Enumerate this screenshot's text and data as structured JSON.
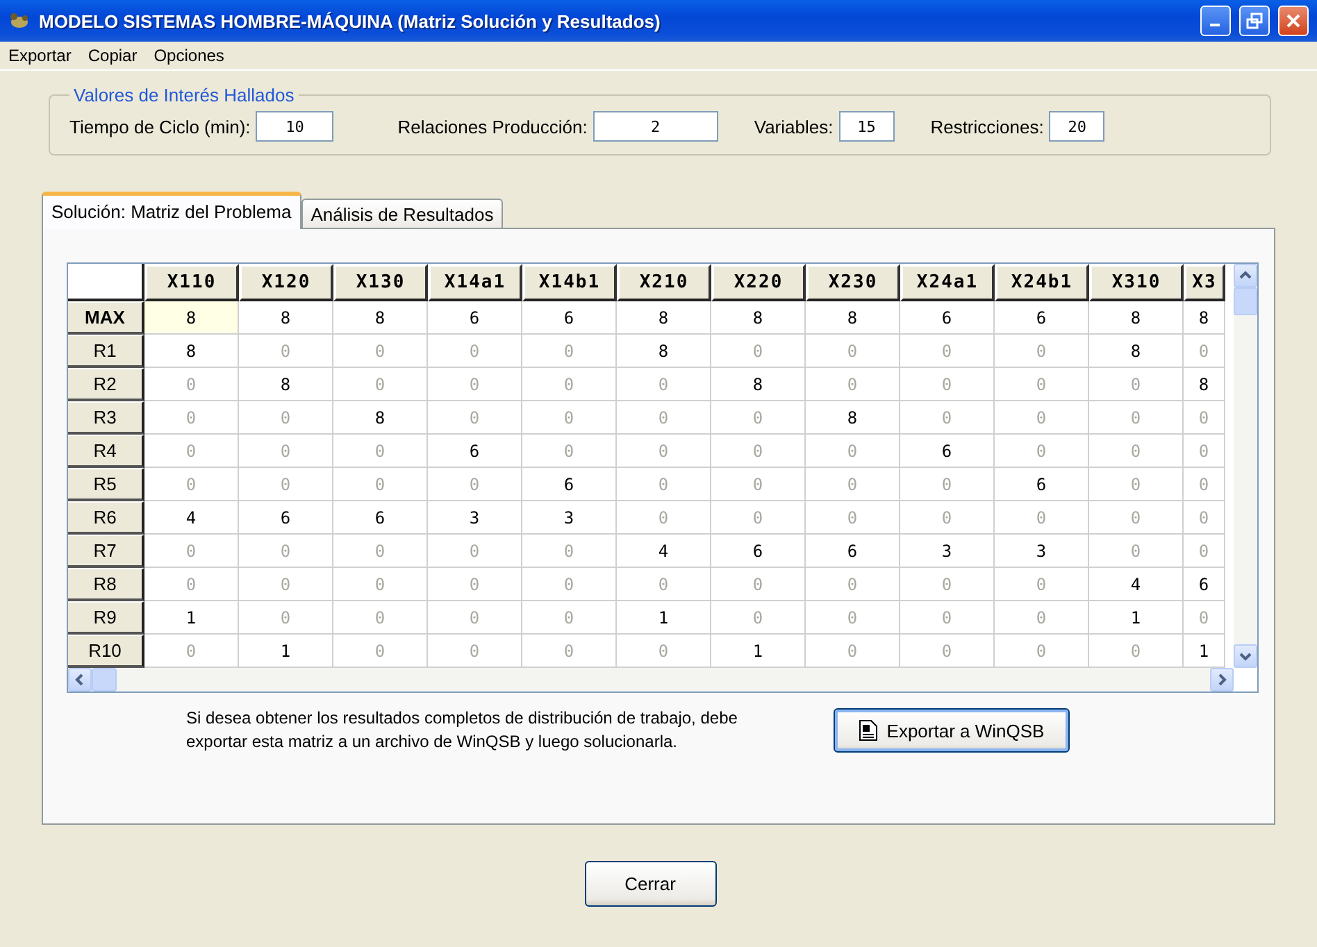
{
  "window": {
    "title": "MODELO SISTEMAS HOMBRE-MÁQUINA (Matriz Solución y Resultados)"
  },
  "menu": [
    "Exportar",
    "Copiar",
    "Opciones"
  ],
  "summary": {
    "title": "Valores de Interés Hallados",
    "fields": [
      {
        "label": "Tiempo de Ciclo (min):",
        "value": "10"
      },
      {
        "label": "Relaciones Producción:",
        "value": "2"
      },
      {
        "label": "Variables:",
        "value": "15"
      },
      {
        "label": "Restricciones:",
        "value": "20"
      }
    ]
  },
  "tabs": [
    {
      "label": "Solución: Matriz del Problema",
      "selected": true
    },
    {
      "label": "Análisis de Resultados",
      "selected": false
    }
  ],
  "table": {
    "columns": [
      "X110",
      "X120",
      "X130",
      "X14a1",
      "X14b1",
      "X210",
      "X220",
      "X230",
      "X24a1",
      "X24b1",
      "X310",
      "X3"
    ],
    "rows": [
      {
        "header": "MAX",
        "cells": [
          {
            "v": "8",
            "selected": true
          },
          {
            "v": "8",
            "selected": false
          },
          {
            "v": "8",
            "selected": false
          },
          {
            "v": "6",
            "selected": false
          },
          {
            "v": "6",
            "selected": false
          },
          {
            "v": "8",
            "selected": false
          },
          {
            "v": "8",
            "selected": false
          },
          {
            "v": "8",
            "selected": false
          },
          {
            "v": "6",
            "selected": false
          },
          {
            "v": "6",
            "selected": false
          },
          {
            "v": "8",
            "selected": false
          },
          {
            "v": "8",
            "selected": false
          }
        ]
      },
      {
        "header": "R1",
        "cells": [
          {
            "v": "8",
            "selected": false
          },
          {
            "v": "0",
            "selected": false
          },
          {
            "v": "0",
            "selected": false
          },
          {
            "v": "0",
            "selected": false
          },
          {
            "v": "0",
            "selected": false
          },
          {
            "v": "8",
            "selected": false
          },
          {
            "v": "0",
            "selected": false
          },
          {
            "v": "0",
            "selected": false
          },
          {
            "v": "0",
            "selected": false
          },
          {
            "v": "0",
            "selected": false
          },
          {
            "v": "8",
            "selected": false
          },
          {
            "v": "0",
            "selected": false
          }
        ]
      },
      {
        "header": "R2",
        "cells": [
          {
            "v": "0",
            "selected": false
          },
          {
            "v": "8",
            "selected": false
          },
          {
            "v": "0",
            "selected": false
          },
          {
            "v": "0",
            "selected": false
          },
          {
            "v": "0",
            "selected": false
          },
          {
            "v": "0",
            "selected": false
          },
          {
            "v": "8",
            "selected": false
          },
          {
            "v": "0",
            "selected": false
          },
          {
            "v": "0",
            "selected": false
          },
          {
            "v": "0",
            "selected": false
          },
          {
            "v": "0",
            "selected": false
          },
          {
            "v": "8",
            "selected": false
          }
        ]
      },
      {
        "header": "R3",
        "cells": [
          {
            "v": "0",
            "selected": false
          },
          {
            "v": "0",
            "selected": false
          },
          {
            "v": "8",
            "selected": false
          },
          {
            "v": "0",
            "selected": false
          },
          {
            "v": "0",
            "selected": false
          },
          {
            "v": "0",
            "selected": false
          },
          {
            "v": "0",
            "selected": false
          },
          {
            "v": "8",
            "selected": false
          },
          {
            "v": "0",
            "selected": false
          },
          {
            "v": "0",
            "selected": false
          },
          {
            "v": "0",
            "selected": false
          },
          {
            "v": "0",
            "selected": false
          }
        ]
      },
      {
        "header": "R4",
        "cells": [
          {
            "v": "0",
            "selected": false
          },
          {
            "v": "0",
            "selected": false
          },
          {
            "v": "0",
            "selected": false
          },
          {
            "v": "6",
            "selected": false
          },
          {
            "v": "0",
            "selected": false
          },
          {
            "v": "0",
            "selected": false
          },
          {
            "v": "0",
            "selected": false
          },
          {
            "v": "0",
            "selected": false
          },
          {
            "v": "6",
            "selected": false
          },
          {
            "v": "0",
            "selected": false
          },
          {
            "v": "0",
            "selected": false
          },
          {
            "v": "0",
            "selected": false
          }
        ]
      },
      {
        "header": "R5",
        "cells": [
          {
            "v": "0",
            "selected": false
          },
          {
            "v": "0",
            "selected": false
          },
          {
            "v": "0",
            "selected": false
          },
          {
            "v": "0",
            "selected": false
          },
          {
            "v": "6",
            "selected": false
          },
          {
            "v": "0",
            "selected": false
          },
          {
            "v": "0",
            "selected": false
          },
          {
            "v": "0",
            "selected": false
          },
          {
            "v": "0",
            "selected": false
          },
          {
            "v": "6",
            "selected": false
          },
          {
            "v": "0",
            "selected": false
          },
          {
            "v": "0",
            "selected": false
          }
        ]
      },
      {
        "header": "R6",
        "cells": [
          {
            "v": "4",
            "selected": false
          },
          {
            "v": "6",
            "selected": false
          },
          {
            "v": "6",
            "selected": false
          },
          {
            "v": "3",
            "selected": false
          },
          {
            "v": "3",
            "selected": false
          },
          {
            "v": "0",
            "selected": false
          },
          {
            "v": "0",
            "selected": false
          },
          {
            "v": "0",
            "selected": false
          },
          {
            "v": "0",
            "selected": false
          },
          {
            "v": "0",
            "selected": false
          },
          {
            "v": "0",
            "selected": false
          },
          {
            "v": "0",
            "selected": false
          }
        ]
      },
      {
        "header": "R7",
        "cells": [
          {
            "v": "0",
            "selected": false
          },
          {
            "v": "0",
            "selected": false
          },
          {
            "v": "0",
            "selected": false
          },
          {
            "v": "0",
            "selected": false
          },
          {
            "v": "0",
            "selected": false
          },
          {
            "v": "4",
            "selected": false
          },
          {
            "v": "6",
            "selected": false
          },
          {
            "v": "6",
            "selected": false
          },
          {
            "v": "3",
            "selected": false
          },
          {
            "v": "3",
            "selected": false
          },
          {
            "v": "0",
            "selected": false
          },
          {
            "v": "0",
            "selected": false
          }
        ]
      },
      {
        "header": "R8",
        "cells": [
          {
            "v": "0",
            "selected": false
          },
          {
            "v": "0",
            "selected": false
          },
          {
            "v": "0",
            "selected": false
          },
          {
            "v": "0",
            "selected": false
          },
          {
            "v": "0",
            "selected": false
          },
          {
            "v": "0",
            "selected": false
          },
          {
            "v": "0",
            "selected": false
          },
          {
            "v": "0",
            "selected": false
          },
          {
            "v": "0",
            "selected": false
          },
          {
            "v": "0",
            "selected": false
          },
          {
            "v": "4",
            "selected": false
          },
          {
            "v": "6",
            "selected": false
          }
        ]
      },
      {
        "header": "R9",
        "cells": [
          {
            "v": "1",
            "selected": false
          },
          {
            "v": "0",
            "selected": false
          },
          {
            "v": "0",
            "selected": false
          },
          {
            "v": "0",
            "selected": false
          },
          {
            "v": "0",
            "selected": false
          },
          {
            "v": "1",
            "selected": false
          },
          {
            "v": "0",
            "selected": false
          },
          {
            "v": "0",
            "selected": false
          },
          {
            "v": "0",
            "selected": false
          },
          {
            "v": "0",
            "selected": false
          },
          {
            "v": "1",
            "selected": false
          },
          {
            "v": "0",
            "selected": false
          }
        ]
      },
      {
        "header": "R10",
        "cells": [
          {
            "v": "0",
            "selected": false
          },
          {
            "v": "1",
            "selected": false
          },
          {
            "v": "0",
            "selected": false
          },
          {
            "v": "0",
            "selected": false
          },
          {
            "v": "0",
            "selected": false
          },
          {
            "v": "0",
            "selected": false
          },
          {
            "v": "1",
            "selected": false
          },
          {
            "v": "0",
            "selected": false
          },
          {
            "v": "0",
            "selected": false
          },
          {
            "v": "0",
            "selected": false
          },
          {
            "v": "0",
            "selected": false
          },
          {
            "v": "1",
            "selected": false
          }
        ]
      }
    ]
  },
  "note": "Si desea obtener los resultados completos de distribución de trabajo, debe exportar esta matriz a un archivo de WinQSB y luego solucionarla.",
  "export_button": "Exportar a WinQSB",
  "close_button": "Cerrar"
}
